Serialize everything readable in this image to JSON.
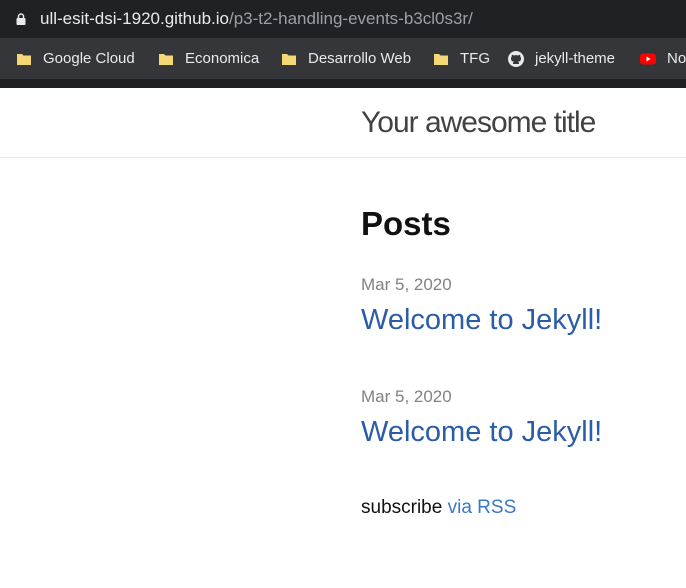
{
  "browser": {
    "url_host": "ull-esit-dsi-1920.github.io",
    "url_path": "/p3-t2-handling-events-b3cl0s3r/",
    "bookmarks": [
      {
        "label": "Google Cloud",
        "icon": "folder-icon"
      },
      {
        "label": "Economica",
        "icon": "folder-icon"
      },
      {
        "label": "Desarrollo Web",
        "icon": "folder-icon"
      },
      {
        "label": "TFG",
        "icon": "folder-icon"
      },
      {
        "label": "jekyll-theme",
        "icon": "github-icon"
      },
      {
        "label": "No",
        "icon": "youtube-icon"
      }
    ]
  },
  "site": {
    "title": "Your awesome title"
  },
  "main": {
    "heading": "Posts",
    "posts": [
      {
        "date": "Mar 5, 2020",
        "title": "Welcome to Jekyll!"
      },
      {
        "date": "Mar 5, 2020",
        "title": "Welcome to Jekyll!"
      }
    ],
    "subscribe_text": "subscribe",
    "rss_link": "via RSS"
  },
  "colors": {
    "link": "#2a5ca8",
    "meta": "#828282",
    "chrome_dark": "#202124",
    "bookmarks_bar": "#35363a",
    "folder": "#f6d776"
  }
}
